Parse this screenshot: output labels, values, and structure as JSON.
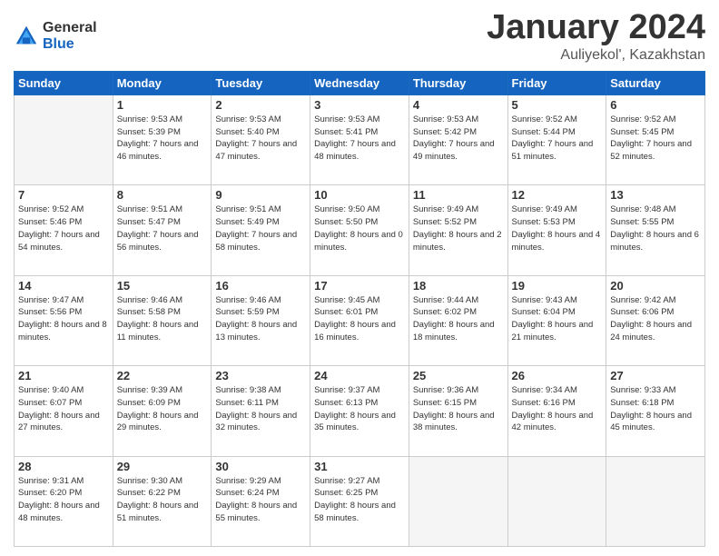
{
  "header": {
    "logo_general": "General",
    "logo_blue": "Blue",
    "title": "January 2024",
    "subtitle": "Auliyekol', Kazakhstan"
  },
  "calendar": {
    "days_of_week": [
      "Sunday",
      "Monday",
      "Tuesday",
      "Wednesday",
      "Thursday",
      "Friday",
      "Saturday"
    ],
    "weeks": [
      [
        {
          "day": "",
          "sunrise": "",
          "sunset": "",
          "daylight": "",
          "empty": true
        },
        {
          "day": "1",
          "sunrise": "Sunrise: 9:53 AM",
          "sunset": "Sunset: 5:39 PM",
          "daylight": "Daylight: 7 hours and 46 minutes."
        },
        {
          "day": "2",
          "sunrise": "Sunrise: 9:53 AM",
          "sunset": "Sunset: 5:40 PM",
          "daylight": "Daylight: 7 hours and 47 minutes."
        },
        {
          "day": "3",
          "sunrise": "Sunrise: 9:53 AM",
          "sunset": "Sunset: 5:41 PM",
          "daylight": "Daylight: 7 hours and 48 minutes."
        },
        {
          "day": "4",
          "sunrise": "Sunrise: 9:53 AM",
          "sunset": "Sunset: 5:42 PM",
          "daylight": "Daylight: 7 hours and 49 minutes."
        },
        {
          "day": "5",
          "sunrise": "Sunrise: 9:52 AM",
          "sunset": "Sunset: 5:44 PM",
          "daylight": "Daylight: 7 hours and 51 minutes."
        },
        {
          "day": "6",
          "sunrise": "Sunrise: 9:52 AM",
          "sunset": "Sunset: 5:45 PM",
          "daylight": "Daylight: 7 hours and 52 minutes."
        }
      ],
      [
        {
          "day": "7",
          "sunrise": "Sunrise: 9:52 AM",
          "sunset": "Sunset: 5:46 PM",
          "daylight": "Daylight: 7 hours and 54 minutes."
        },
        {
          "day": "8",
          "sunrise": "Sunrise: 9:51 AM",
          "sunset": "Sunset: 5:47 PM",
          "daylight": "Daylight: 7 hours and 56 minutes."
        },
        {
          "day": "9",
          "sunrise": "Sunrise: 9:51 AM",
          "sunset": "Sunset: 5:49 PM",
          "daylight": "Daylight: 7 hours and 58 minutes."
        },
        {
          "day": "10",
          "sunrise": "Sunrise: 9:50 AM",
          "sunset": "Sunset: 5:50 PM",
          "daylight": "Daylight: 8 hours and 0 minutes."
        },
        {
          "day": "11",
          "sunrise": "Sunrise: 9:49 AM",
          "sunset": "Sunset: 5:52 PM",
          "daylight": "Daylight: 8 hours and 2 minutes."
        },
        {
          "day": "12",
          "sunrise": "Sunrise: 9:49 AM",
          "sunset": "Sunset: 5:53 PM",
          "daylight": "Daylight: 8 hours and 4 minutes."
        },
        {
          "day": "13",
          "sunrise": "Sunrise: 9:48 AM",
          "sunset": "Sunset: 5:55 PM",
          "daylight": "Daylight: 8 hours and 6 minutes."
        }
      ],
      [
        {
          "day": "14",
          "sunrise": "Sunrise: 9:47 AM",
          "sunset": "Sunset: 5:56 PM",
          "daylight": "Daylight: 8 hours and 8 minutes."
        },
        {
          "day": "15",
          "sunrise": "Sunrise: 9:46 AM",
          "sunset": "Sunset: 5:58 PM",
          "daylight": "Daylight: 8 hours and 11 minutes."
        },
        {
          "day": "16",
          "sunrise": "Sunrise: 9:46 AM",
          "sunset": "Sunset: 5:59 PM",
          "daylight": "Daylight: 8 hours and 13 minutes."
        },
        {
          "day": "17",
          "sunrise": "Sunrise: 9:45 AM",
          "sunset": "Sunset: 6:01 PM",
          "daylight": "Daylight: 8 hours and 16 minutes."
        },
        {
          "day": "18",
          "sunrise": "Sunrise: 9:44 AM",
          "sunset": "Sunset: 6:02 PM",
          "daylight": "Daylight: 8 hours and 18 minutes."
        },
        {
          "day": "19",
          "sunrise": "Sunrise: 9:43 AM",
          "sunset": "Sunset: 6:04 PM",
          "daylight": "Daylight: 8 hours and 21 minutes."
        },
        {
          "day": "20",
          "sunrise": "Sunrise: 9:42 AM",
          "sunset": "Sunset: 6:06 PM",
          "daylight": "Daylight: 8 hours and 24 minutes."
        }
      ],
      [
        {
          "day": "21",
          "sunrise": "Sunrise: 9:40 AM",
          "sunset": "Sunset: 6:07 PM",
          "daylight": "Daylight: 8 hours and 27 minutes."
        },
        {
          "day": "22",
          "sunrise": "Sunrise: 9:39 AM",
          "sunset": "Sunset: 6:09 PM",
          "daylight": "Daylight: 8 hours and 29 minutes."
        },
        {
          "day": "23",
          "sunrise": "Sunrise: 9:38 AM",
          "sunset": "Sunset: 6:11 PM",
          "daylight": "Daylight: 8 hours and 32 minutes."
        },
        {
          "day": "24",
          "sunrise": "Sunrise: 9:37 AM",
          "sunset": "Sunset: 6:13 PM",
          "daylight": "Daylight: 8 hours and 35 minutes."
        },
        {
          "day": "25",
          "sunrise": "Sunrise: 9:36 AM",
          "sunset": "Sunset: 6:15 PM",
          "daylight": "Daylight: 8 hours and 38 minutes."
        },
        {
          "day": "26",
          "sunrise": "Sunrise: 9:34 AM",
          "sunset": "Sunset: 6:16 PM",
          "daylight": "Daylight: 8 hours and 42 minutes."
        },
        {
          "day": "27",
          "sunrise": "Sunrise: 9:33 AM",
          "sunset": "Sunset: 6:18 PM",
          "daylight": "Daylight: 8 hours and 45 minutes."
        }
      ],
      [
        {
          "day": "28",
          "sunrise": "Sunrise: 9:31 AM",
          "sunset": "Sunset: 6:20 PM",
          "daylight": "Daylight: 8 hours and 48 minutes."
        },
        {
          "day": "29",
          "sunrise": "Sunrise: 9:30 AM",
          "sunset": "Sunset: 6:22 PM",
          "daylight": "Daylight: 8 hours and 51 minutes."
        },
        {
          "day": "30",
          "sunrise": "Sunrise: 9:29 AM",
          "sunset": "Sunset: 6:24 PM",
          "daylight": "Daylight: 8 hours and 55 minutes."
        },
        {
          "day": "31",
          "sunrise": "Sunrise: 9:27 AM",
          "sunset": "Sunset: 6:25 PM",
          "daylight": "Daylight: 8 hours and 58 minutes."
        },
        {
          "day": "",
          "sunrise": "",
          "sunset": "",
          "daylight": "",
          "empty": true
        },
        {
          "day": "",
          "sunrise": "",
          "sunset": "",
          "daylight": "",
          "empty": true
        },
        {
          "day": "",
          "sunrise": "",
          "sunset": "",
          "daylight": "",
          "empty": true
        }
      ]
    ]
  }
}
